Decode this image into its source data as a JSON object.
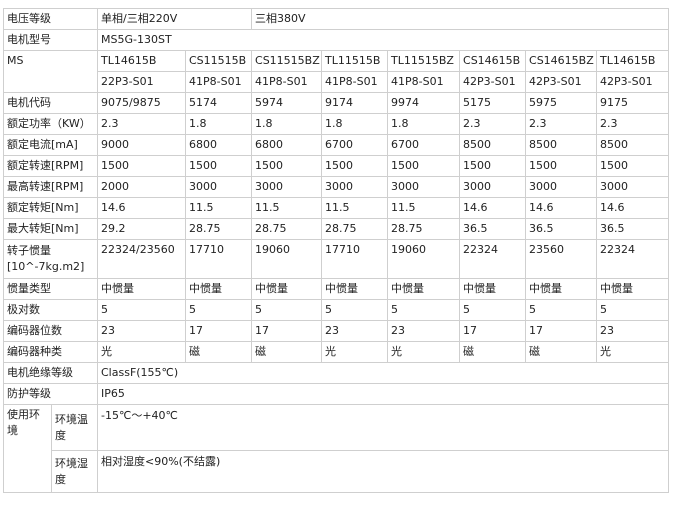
{
  "voltage": {
    "label": "电压等级",
    "single": "单相/三相220V",
    "three": "三相380V"
  },
  "model": {
    "label": "电机型号",
    "series": "MS5G-130ST",
    "ms": "MS"
  },
  "columns": [
    {
      "model": "TL14615B",
      "code": "22P3-S01"
    },
    {
      "model": "CS11515B",
      "code": "41P8-S01"
    },
    {
      "model": "CS11515BZ",
      "code": "41P8-S01"
    },
    {
      "model": "TL11515B",
      "code": "41P8-S01"
    },
    {
      "model": "TL11515BZ",
      "code": "41P8-S01"
    },
    {
      "model": "CS14615B",
      "code": "42P3-S01"
    },
    {
      "model": "CS14615BZ",
      "code": "42P3-S01"
    },
    {
      "model": "TL14615B",
      "code": "42P3-S01"
    }
  ],
  "rows": [
    {
      "label": "电机代码",
      "values": [
        "9075/9875",
        "5174",
        "5974",
        "9174",
        "9974",
        "5175",
        "5975",
        "9175"
      ]
    },
    {
      "label": "额定功率（KW）",
      "values": [
        "2.3",
        "1.8",
        "1.8",
        "1.8",
        "1.8",
        "2.3",
        "2.3",
        "2.3"
      ]
    },
    {
      "label": "额定电流[mA]",
      "values": [
        "9000",
        "6800",
        "6800",
        "6700",
        "6700",
        "8500",
        "8500",
        "8500"
      ]
    },
    {
      "label": "额定转速[RPM]",
      "values": [
        "1500",
        "1500",
        "1500",
        "1500",
        "1500",
        "1500",
        "1500",
        "1500"
      ]
    },
    {
      "label": "最高转速[RPM]",
      "values": [
        "2000",
        "3000",
        "3000",
        "3000",
        "3000",
        "3000",
        "3000",
        "3000"
      ]
    },
    {
      "label": "额定转矩[Nm]",
      "values": [
        "14.6",
        "11.5",
        "11.5",
        "11.5",
        "11.5",
        "14.6",
        "14.6",
        "14.6"
      ]
    },
    {
      "label": "最大转矩[Nm]",
      "values": [
        "29.2",
        "28.75",
        "28.75",
        "28.75",
        "28.75",
        "36.5",
        "36.5",
        "36.5"
      ]
    }
  ],
  "inertia": {
    "label": "转子惯量[10^-7kg.m2]",
    "values": [
      "22324/23560",
      "17710",
      "19060",
      "17710",
      "19060",
      "22324",
      "23560",
      "22324"
    ]
  },
  "rows2": [
    {
      "label": "惯量类型",
      "values": [
        "中惯量",
        "中惯量",
        "中惯量",
        "中惯量",
        "中惯量",
        "中惯量",
        "中惯量",
        "中惯量"
      ]
    },
    {
      "label": "极对数",
      "values": [
        "5",
        "5",
        "5",
        "5",
        "5",
        "5",
        "5",
        "5"
      ]
    },
    {
      "label": "编码器位数",
      "values": [
        "23",
        "17",
        "17",
        "23",
        "23",
        "17",
        "17",
        "23"
      ]
    },
    {
      "label": "编码器种类",
      "values": [
        "光",
        "磁",
        "磁",
        "光",
        "光",
        "磁",
        "磁",
        "光"
      ]
    }
  ],
  "insulation": {
    "label": "电机绝缘等级",
    "value": "ClassF(155℃)"
  },
  "protection": {
    "label": "防护等级",
    "value": "IP65"
  },
  "environment": {
    "label": "使用环境",
    "temp_label": "环境温度",
    "temp_value": "-15℃～+40℃",
    "humidity_label": "环境湿度",
    "humidity_value": "相对湿度<90%(不结露)"
  }
}
